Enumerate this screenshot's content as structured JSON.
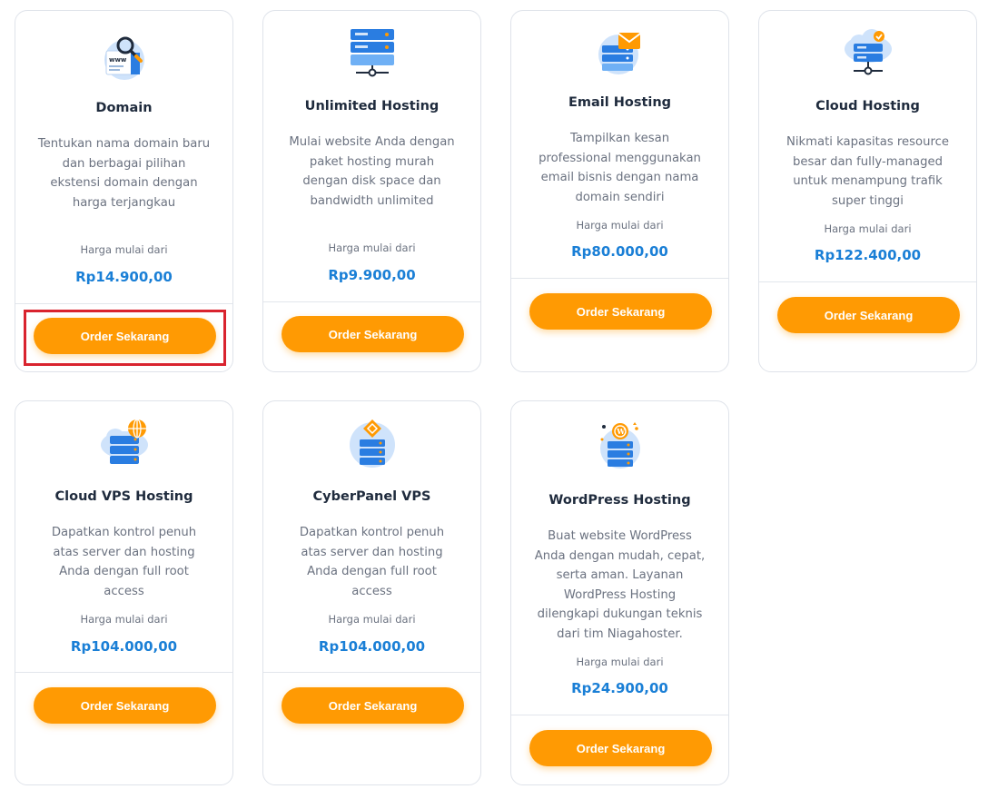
{
  "products": [
    {
      "icon": "domain-search-icon",
      "title": "Domain",
      "description": "Tentukan nama domain baru dan berbagai pilihan ekstensi domain dengan harga terjangkau",
      "price_label": "Harga mulai dari",
      "price": "Rp14.900,00",
      "button_label": "Order Sekarang"
    },
    {
      "icon": "server-network-icon",
      "title": "Unlimited Hosting",
      "description": "Mulai website Anda dengan paket hosting murah dengan disk space dan bandwidth unlimited",
      "price_label": "Harga mulai dari",
      "price": "Rp9.900,00",
      "button_label": "Order Sekarang"
    },
    {
      "icon": "email-server-icon",
      "title": "Email Hosting",
      "description": "Tampilkan kesan professional menggunakan email bisnis dengan nama domain sendiri",
      "price_label": "Harga mulai dari",
      "price": "Rp80.000,00",
      "button_label": "Order Sekarang"
    },
    {
      "icon": "cloud-network-icon",
      "title": "Cloud Hosting",
      "description": "Nikmati kapasitas resource besar dan fully-managed untuk menampung trafik super tinggi",
      "price_label": "Harga mulai dari",
      "price": "Rp122.400,00",
      "button_label": "Order Sekarang"
    },
    {
      "icon": "cloud-vps-globe-icon",
      "title": "Cloud VPS Hosting",
      "description": "Dapatkan kontrol penuh atas server dan hosting Anda dengan full root access",
      "price_label": "Harga mulai dari",
      "price": "Rp104.000,00",
      "button_label": "Order Sekarang"
    },
    {
      "icon": "cyberpanel-server-icon",
      "title": "CyberPanel VPS",
      "description": "Dapatkan kontrol penuh atas server dan hosting Anda dengan full root access",
      "price_label": "Harga mulai dari",
      "price": "Rp104.000,00",
      "button_label": "Order Sekarang"
    },
    {
      "icon": "wordpress-server-icon",
      "title": "WordPress Hosting",
      "description": "Buat website WordPress Anda dengan mudah, cepat, serta aman. Layanan WordPress Hosting dilengkapi dukungan teknis dari tim Niagahoster.",
      "price_label": "Harga mulai dari",
      "price": "Rp24.900,00",
      "button_label": "Order Sekarang"
    }
  ],
  "colors": {
    "accent_orange": "#ff9a03",
    "price_blue": "#1a7fd6",
    "icon_blue": "#2a7de1",
    "highlight_red": "#d9232e"
  }
}
